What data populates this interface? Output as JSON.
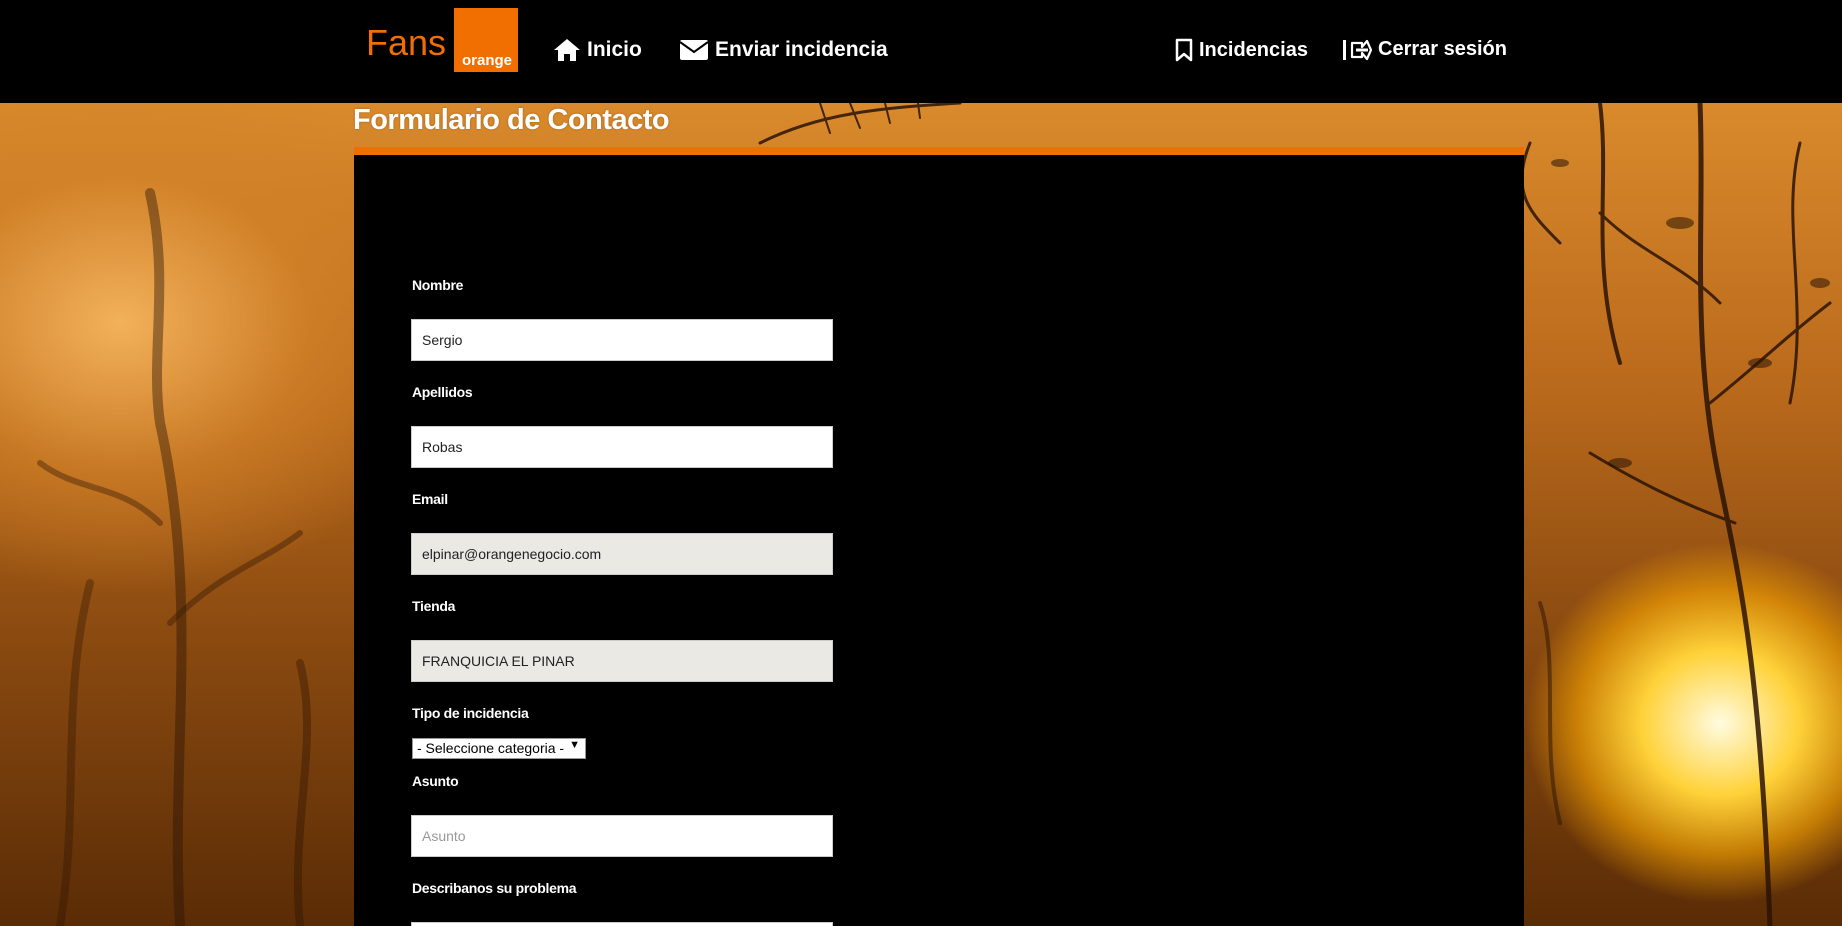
{
  "header": {
    "logo_text": "Fans",
    "logo_badge": "orange",
    "nav_home": "Inicio",
    "nav_send": "Enviar incidencia",
    "nav_incidents": "Incidencias",
    "nav_logout": "Cerrar sesión"
  },
  "page": {
    "title": "Formulario de Contacto"
  },
  "form": {
    "nombre_label": "Nombre",
    "nombre_value": "Sergio",
    "apellidos_label": "Apellidos",
    "apellidos_value": "Robas",
    "email_label": "Email",
    "email_value": "elpinar@orangenegocio.com",
    "tienda_label": "Tienda",
    "tienda_value": "FRANQUICIA EL PINAR",
    "tipo_label": "Tipo de incidencia",
    "tipo_selected": "- Seleccione categoria -",
    "asunto_label": "Asunto",
    "asunto_placeholder": "Asunto",
    "problema_label": "Describanos su problema"
  },
  "colors": {
    "brand_orange": "#f16e00",
    "panel_bg": "#000000",
    "readonly_field_bg": "#eae9e4"
  },
  "icons": [
    "home-icon",
    "envelope-icon",
    "bookmark-icon",
    "logout-icon"
  ]
}
